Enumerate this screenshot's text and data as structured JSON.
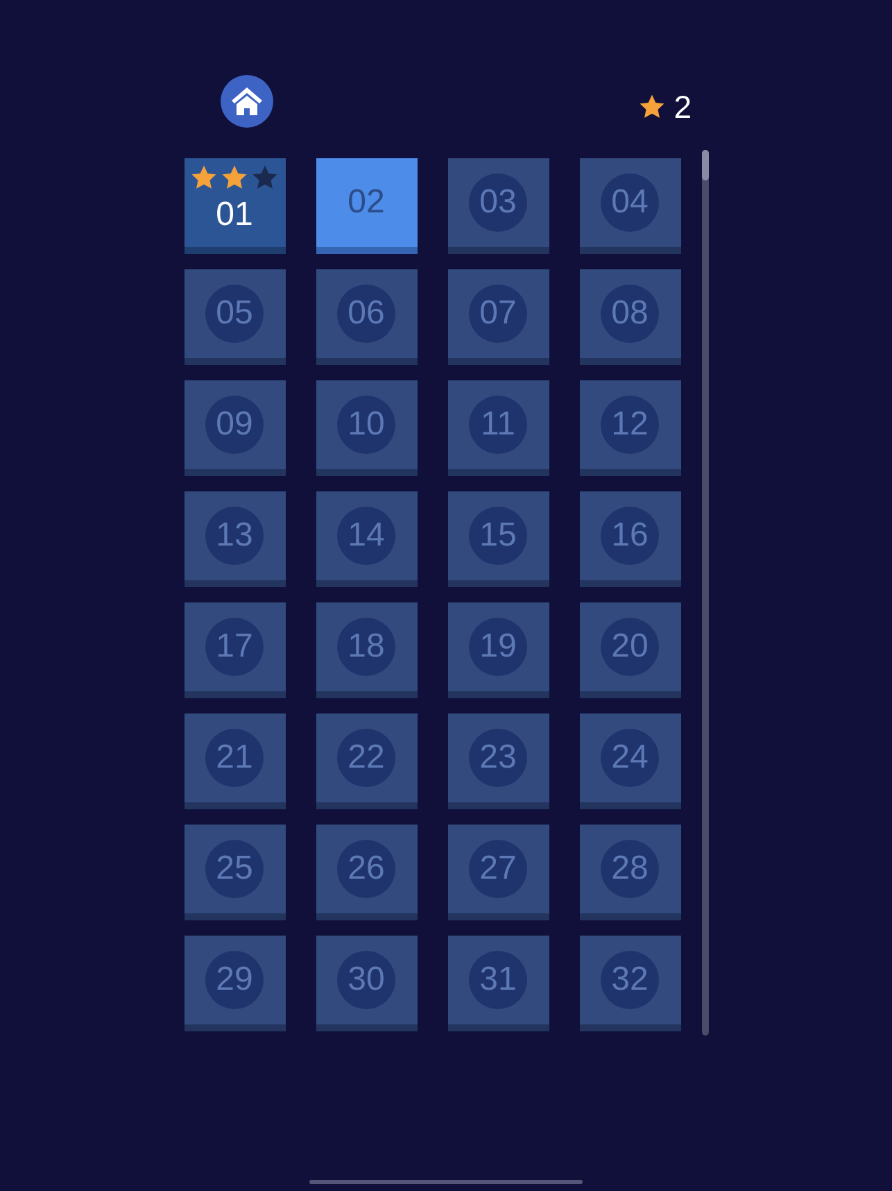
{
  "header": {
    "star_total": "2"
  },
  "levels": [
    {
      "label": "01",
      "kind": "completed",
      "stars": 2
    },
    {
      "label": "02",
      "kind": "current"
    },
    {
      "label": "03",
      "kind": "locked"
    },
    {
      "label": "04",
      "kind": "locked"
    },
    {
      "label": "05",
      "kind": "locked"
    },
    {
      "label": "06",
      "kind": "locked"
    },
    {
      "label": "07",
      "kind": "locked"
    },
    {
      "label": "08",
      "kind": "locked"
    },
    {
      "label": "09",
      "kind": "locked"
    },
    {
      "label": "10",
      "kind": "locked"
    },
    {
      "label": "11",
      "kind": "locked"
    },
    {
      "label": "12",
      "kind": "locked"
    },
    {
      "label": "13",
      "kind": "locked"
    },
    {
      "label": "14",
      "kind": "locked"
    },
    {
      "label": "15",
      "kind": "locked"
    },
    {
      "label": "16",
      "kind": "locked"
    },
    {
      "label": "17",
      "kind": "locked"
    },
    {
      "label": "18",
      "kind": "locked"
    },
    {
      "label": "19",
      "kind": "locked"
    },
    {
      "label": "20",
      "kind": "locked"
    },
    {
      "label": "21",
      "kind": "locked"
    },
    {
      "label": "22",
      "kind": "locked"
    },
    {
      "label": "23",
      "kind": "locked"
    },
    {
      "label": "24",
      "kind": "locked"
    },
    {
      "label": "25",
      "kind": "locked"
    },
    {
      "label": "26",
      "kind": "locked"
    },
    {
      "label": "27",
      "kind": "locked"
    },
    {
      "label": "28",
      "kind": "locked"
    },
    {
      "label": "29",
      "kind": "locked"
    },
    {
      "label": "30",
      "kind": "locked"
    },
    {
      "label": "31",
      "kind": "locked"
    },
    {
      "label": "32",
      "kind": "locked"
    }
  ]
}
